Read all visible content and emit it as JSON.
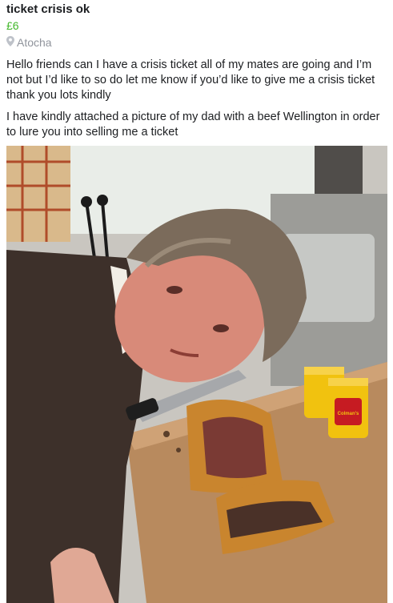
{
  "listing": {
    "title": "ticket crisis ok",
    "price": "£6",
    "location": "Atocha",
    "location_icon": "map-pin-icon",
    "paragraphs": [
      "Hello friends can I have a crisis ticket all of my mates are going and I’m not but I’d like to so do let me know if you’d like to give me a crisis ticket thank you lots kindly",
      "I have kindly attached a picture of my dad with a beef Wellington in order to lure you into selling me a ticket"
    ]
  },
  "photo": {
    "mustard_label": "Colman's Mustard",
    "colors": {
      "jumper": "#3d302a",
      "skin": "#d88a79",
      "hair": "#7b6b5b",
      "board": "#b88a5e",
      "pastry": "#c9852e",
      "beef": "#7a3a34",
      "mustard": "#f1c20f"
    }
  }
}
